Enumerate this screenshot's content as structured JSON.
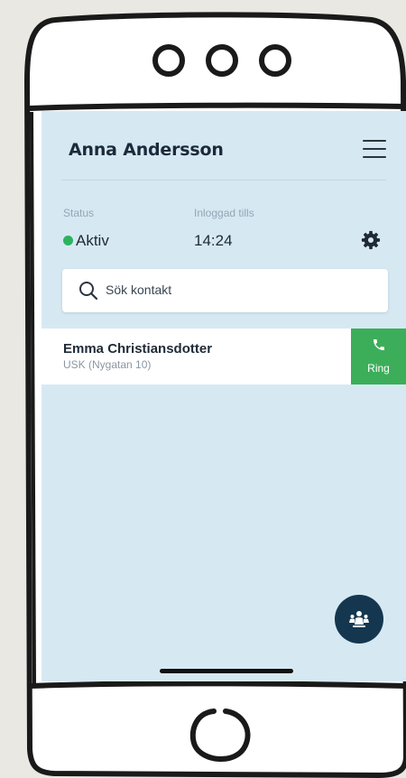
{
  "header": {
    "name": "Anna Andersson",
    "menu_icon": "hamburger-icon"
  },
  "status": {
    "status_label": "Status",
    "status_value": "Aktiv",
    "status_color": "#2db35f",
    "logged_label": "Inloggad tills",
    "logged_value": "14:24",
    "settings_icon": "gear-icon"
  },
  "search": {
    "placeholder": "Sök kontakt",
    "icon": "search-icon"
  },
  "contacts": [
    {
      "name": "Emma Christiansdotter",
      "location": "USK (Nygatan 10)",
      "action_label": "Ring",
      "action_icon": "phone-icon",
      "action_color": "#3cae5a"
    }
  ],
  "fab": {
    "icon": "group-icon",
    "color": "#14374f"
  },
  "colors": {
    "screen_bg": "#d6e9f3",
    "background": "#e9e8e2"
  }
}
